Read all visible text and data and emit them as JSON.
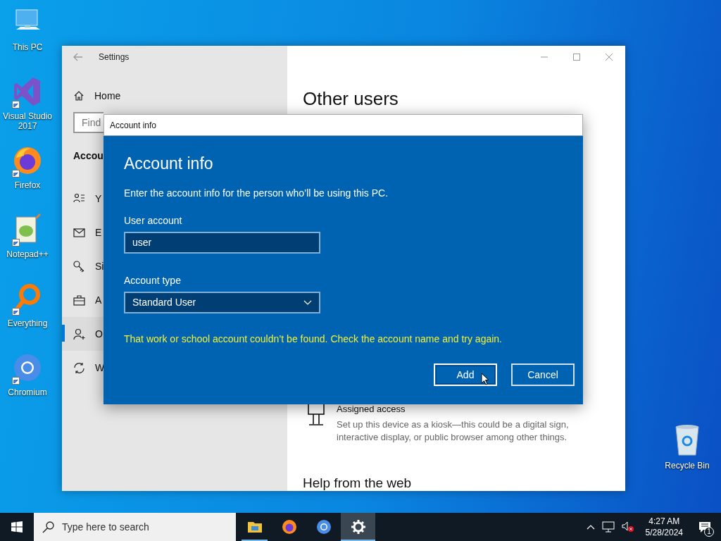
{
  "desktop_icons": [
    {
      "kind": "pc",
      "label": "This PC",
      "shortcut": false
    },
    {
      "kind": "vs",
      "label": "Visual Studio 2017",
      "shortcut": true
    },
    {
      "kind": "firefox",
      "label": "Firefox",
      "shortcut": true
    },
    {
      "kind": "notepad",
      "label": "Notepad++",
      "shortcut": true
    },
    {
      "kind": "everything",
      "label": "Everything",
      "shortcut": true
    },
    {
      "kind": "chromium",
      "label": "Chromium",
      "shortcut": true
    }
  ],
  "recycle_bin": {
    "label": "Recycle Bin"
  },
  "settings_window": {
    "title": "Settings",
    "home": "Home",
    "search": {
      "placeholder": "Find"
    },
    "section": "Accou",
    "nav_items": [
      {
        "kind": "info",
        "label": "Y",
        "selected": false
      },
      {
        "kind": "mail",
        "label": "E",
        "selected": false
      },
      {
        "kind": "key",
        "label": "Si",
        "selected": false
      },
      {
        "kind": "briefcase",
        "label": "A",
        "selected": false
      },
      {
        "kind": "person-add",
        "label": "O",
        "selected": true
      },
      {
        "kind": "sync",
        "label": "W",
        "selected": false
      }
    ],
    "heading": "Other users",
    "assigned_access": {
      "title": "Assigned access",
      "description": "Set up this device as a kiosk—this could be a digital sign, interactive display, or public browser among other things."
    },
    "help_heading": "Help from the web"
  },
  "dialog": {
    "title": "Account info",
    "heading": "Account info",
    "instruction": "Enter the account info for the person who’ll be using this PC.",
    "user_account": {
      "label": "User account",
      "value": "user"
    },
    "account_type": {
      "label": "Account type",
      "value": "Standard User"
    },
    "error": "That work or school account couldn’t be found. Check the account name and try again.",
    "buttons": [
      {
        "label": "Add",
        "focused": true
      },
      {
        "label": "Cancel",
        "focused": false
      }
    ]
  },
  "taskbar": {
    "search": {
      "placeholder": "Type here to search"
    },
    "apps": [
      {
        "kind": "explorer",
        "running": true,
        "selected": false
      },
      {
        "kind": "firefox",
        "running": false,
        "selected": false
      },
      {
        "kind": "chromium",
        "running": false,
        "selected": false
      },
      {
        "kind": "settings",
        "running": true,
        "selected": true
      }
    ],
    "time": "4:27 AM",
    "date": "5/28/2024",
    "notifications": "1"
  }
}
